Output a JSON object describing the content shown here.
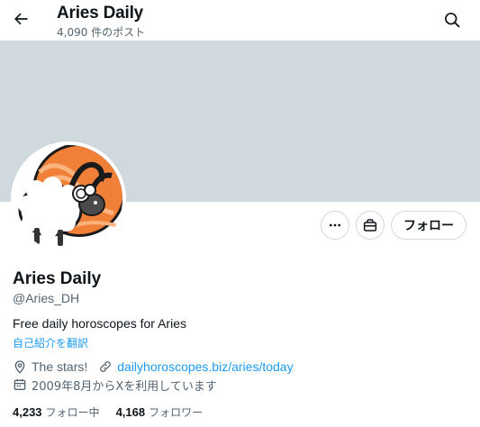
{
  "header": {
    "title": "Aries Daily",
    "post_count": "4,090 件のポスト",
    "back_icon": "arrow-left-icon",
    "search_icon": "search-icon"
  },
  "profile": {
    "name": "Aries Daily",
    "handle": "@Aries_DH",
    "bio": "Free daily horoscopes for Aries",
    "translate_label": "自己紹介を翻訳",
    "location": "The stars!",
    "website": "dailyhoroscopes.biz/aries/today",
    "joined": "2009年8月からXを利用しています"
  },
  "actions": {
    "more_icon": "more-icon",
    "subscribe_icon": "subscribe-icon",
    "follow_label": "フォロー"
  },
  "stats": {
    "following_count": "4,233",
    "following_label": "フォロー中",
    "followers_count": "4,168",
    "followers_label": "フォロワー"
  },
  "colors": {
    "banner": "#cfd9de",
    "link": "#1d9bf0",
    "secondary_text": "#536471",
    "primary_text": "#0f1419",
    "avatar_orange": "#f07f38"
  }
}
